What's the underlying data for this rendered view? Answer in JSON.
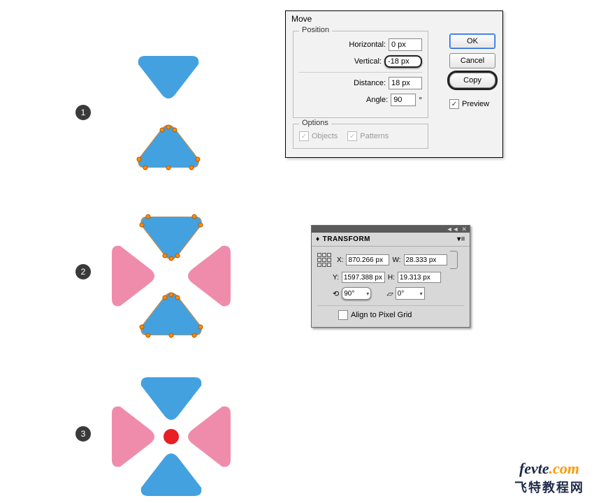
{
  "steps": {
    "1": "1",
    "2": "2",
    "3": "3"
  },
  "move_dialog": {
    "title": "Move",
    "position": {
      "legend": "Position",
      "horizontal_label": "Horizontal:",
      "horizontal_value": "0 px",
      "vertical_label": "Vertical:",
      "vertical_value": "-18 px",
      "distance_label": "Distance:",
      "distance_value": "18 px",
      "angle_label": "Angle:",
      "angle_value": "90",
      "deg": "°"
    },
    "options": {
      "legend": "Options",
      "objects_label": "Objects",
      "patterns_label": "Patterns"
    },
    "buttons": {
      "ok": "OK",
      "cancel": "Cancel",
      "copy": "Copy"
    },
    "preview_label": "Preview"
  },
  "transform_panel": {
    "title": "TRANSFORM",
    "x_label": "X:",
    "x_value": "870.266 px",
    "y_label": "Y:",
    "y_value": "1597.388 px",
    "w_label": "W:",
    "w_value": "28.333 px",
    "h_label": "H:",
    "h_value": "19.313 px",
    "rotate_value": "90°",
    "shear_value": "0°",
    "align_label": "Align to Pixel Grid"
  },
  "colors": {
    "blue": "#44a1e0",
    "pink": "#f08cab",
    "red": "#e62024",
    "anchor": "#ff8a00"
  },
  "watermark": {
    "brand": "fevte",
    "dot_com": ".com",
    "cn": "飞特教程网"
  }
}
